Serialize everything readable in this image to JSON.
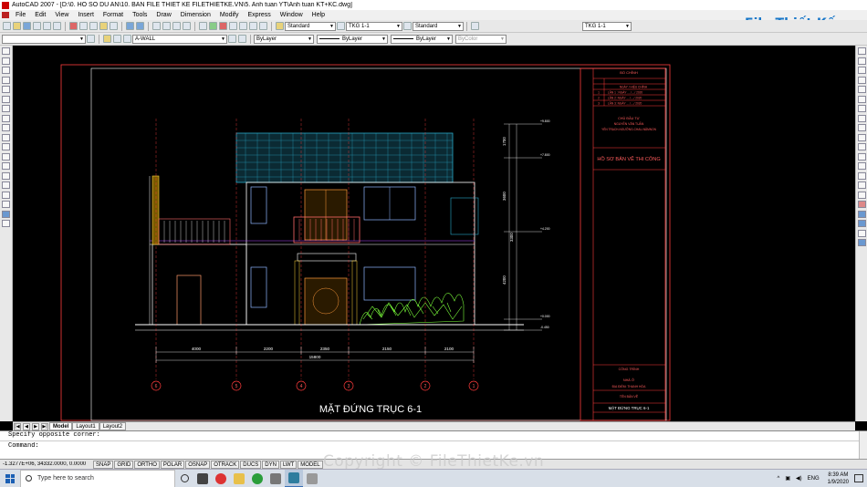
{
  "window": {
    "title": "AutoCAD 2007 - [D:\\0. HO SO DU AN\\10. BAN FILE THIET KE FILETHIETKE.VN\\5. Anh tuan YT\\Anh tuan KT+KC.dwg]"
  },
  "menu": [
    "File",
    "Edit",
    "View",
    "Insert",
    "Format",
    "Tools",
    "Draw",
    "Dimension",
    "Modify",
    "Express",
    "Window",
    "Help"
  ],
  "toolbar": {
    "text_style": "Standard",
    "dim_style": "TKG 1-1",
    "table_style": "Standard",
    "dim_style_2": "TKG 1-1",
    "layer": "A-WALL",
    "color": "ByLayer",
    "linetype": "ByLayer",
    "lineweight": "ByLayer",
    "plot_style": "ByColor"
  },
  "logo": {
    "text": "File Thiết Kế.vn"
  },
  "drawing": {
    "title": "MẶT ĐỨNG TRỤC 6-1",
    "dims_bottom": [
      "4000",
      "2200",
      "2350",
      "2150",
      "2100"
    ],
    "dim_total": "15800",
    "dims_right": [
      "1700",
      "3600",
      "3300",
      "4200"
    ],
    "elevations": [
      "+9.800",
      "+7.800",
      "+4.200",
      "+0.000",
      "-0.450"
    ],
    "axes": [
      "6",
      "5",
      "4",
      "3",
      "2",
      "1"
    ],
    "title_block": {
      "revision_header": "BỔ CHỈNH",
      "revision_col": "NGÀY / HIỆU CHỈNH",
      "revisions": [
        {
          "no": "1",
          "text": "LẦN 1 : NGÀY ..../..../ 2020"
        },
        {
          "no": "2",
          "text": "LẦN 2: NGÀY ..../..../ 2020"
        },
        {
          "no": "3",
          "text": "LẦN 3: NGÀY ..../..../ 2020"
        }
      ],
      "owner_label": "CHỦ ĐẦU TƯ",
      "owner_name": "NGUYỄN VĂN TUẤN",
      "owner_address": "YÊN TRẠCH-NGƯỠNG-CHAU-NĂMNON",
      "stage": "HỒ SƠ BẢN VẼ THI CÔNG",
      "project_label": "CÔNG TRÌNH",
      "project": "NHÀ Ở",
      "location": "ĐỊA ĐIỂM: THANH HÓA",
      "drawing_name_label": "TÊN BẢN VẼ",
      "drawing_name": "MẶT ĐỨNG TRỤC 6-1"
    }
  },
  "layout_tabs": [
    "Model",
    "Layout1",
    "Layout2"
  ],
  "command": {
    "history": "Specify opposite corner:",
    "prompt": "Command:"
  },
  "status": {
    "coords": "-1.3277E+06, 34332.0000, 0.0000",
    "buttons": [
      "SNAP",
      "GRID",
      "ORTHO",
      "POLAR",
      "OSNAP",
      "OTRACK",
      "DUCS",
      "DYN",
      "LWT",
      "MODEL"
    ]
  },
  "watermark": "Copyright © FileThietKe.vn",
  "taskbar": {
    "search_placeholder": "Type here to search",
    "lang": "ENG",
    "time": "8:39 AM",
    "date": "1/9/2020"
  },
  "colors": {
    "canvas_bg": "#000000",
    "title_block_line": "#ff3b3b",
    "wall_line": "#ffffff",
    "roof": "#2aa9c9",
    "dimension": "#ffffff",
    "axis_circle": "#ff3b3b",
    "landscape": "#7cff3b",
    "railing": "#ff6a6a",
    "title_block_text": "#ff5c5c"
  }
}
